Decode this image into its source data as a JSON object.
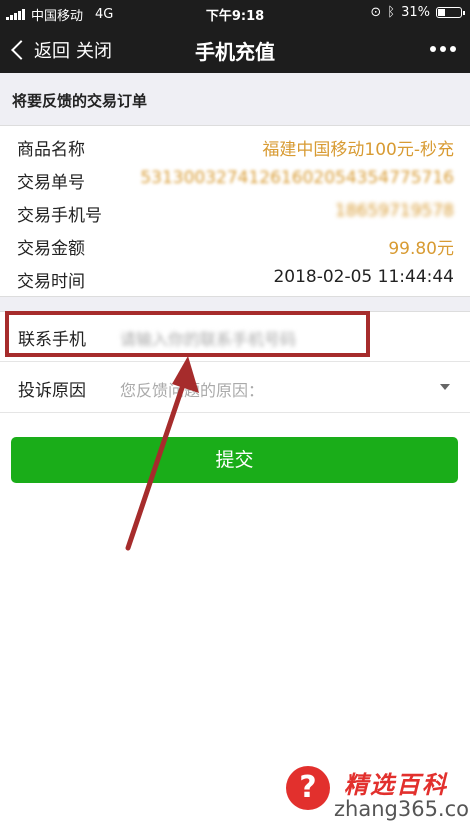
{
  "status_bar": {
    "carrier": "中国移动",
    "network": "4G",
    "time": "下午9:18",
    "battery": "31%"
  },
  "nav": {
    "back_label": "返回",
    "close_label": "关闭",
    "title": "手机充值"
  },
  "order": {
    "heading": "将要反馈的交易订单",
    "rows": [
      {
        "label": "商品名称",
        "value": "福建中国移动100元-秒充"
      },
      {
        "label": "交易单号",
        "value": "53130032741261602054354775716"
      },
      {
        "label": "交易手机号",
        "value": "18659719578"
      },
      {
        "label": "交易金额",
        "value": "99.80元"
      },
      {
        "label": "交易时间",
        "value": "2018-02-05 11:44:44"
      }
    ]
  },
  "form": {
    "contact_label": "联系手机",
    "contact_placeholder": "请输入你的联系手机号码",
    "reason_label": "投诉原因",
    "reason_placeholder": "您反馈问题的原因："
  },
  "submit_label": "提交",
  "watermark": {
    "icon": "question-mark-icon",
    "brand": "精选百科",
    "url": "zhang365.com"
  },
  "colors": {
    "accent_green": "#1aad19",
    "value_orange": "#d89b33",
    "annotation_red": "#a62c2c"
  }
}
